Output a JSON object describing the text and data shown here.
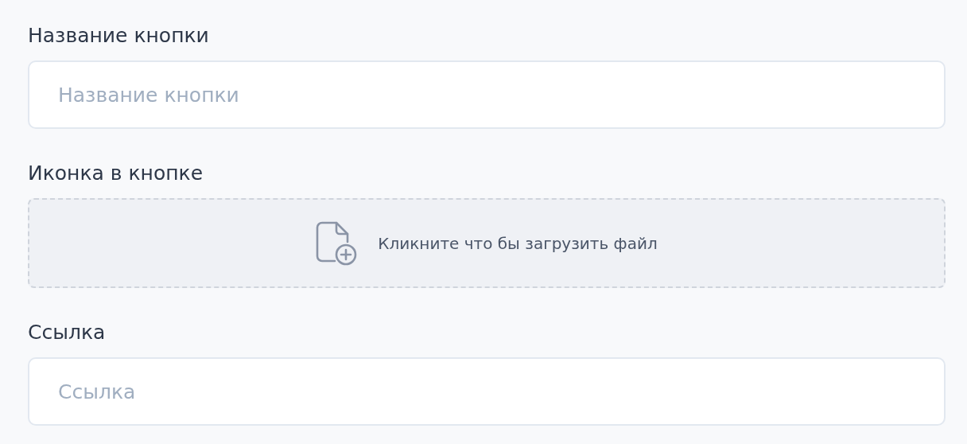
{
  "fields": [
    {
      "kind": "text",
      "label": "Название кнопки",
      "placeholder": "Название кнопки"
    },
    {
      "kind": "upload",
      "label": "Иконка в кнопке",
      "prompt": "Кликните что бы загрузить файл"
    },
    {
      "kind": "text",
      "label": "Ссылка",
      "placeholder": "Ссылка"
    }
  ]
}
